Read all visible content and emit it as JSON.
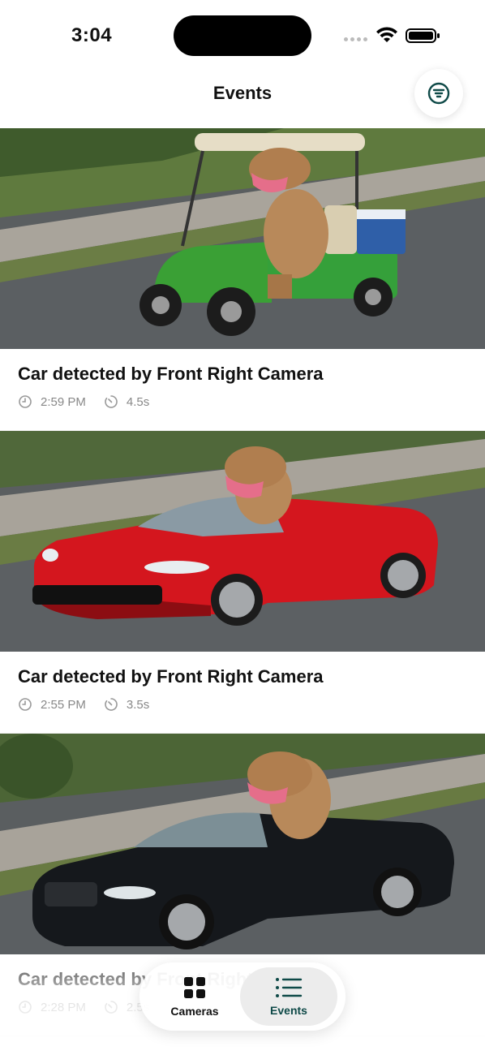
{
  "status_bar": {
    "time": "3:04"
  },
  "header": {
    "title": "Events"
  },
  "theme": {
    "accent": "#0f4a48",
    "secondary_text": "#888888"
  },
  "events": [
    {
      "title": "Car detected by Front Right Camera",
      "time": "2:59 PM",
      "duration": "4.5s"
    },
    {
      "title": "Car detected by Front Right Camera",
      "time": "2:55 PM",
      "duration": "3.5s"
    },
    {
      "title": "Car detected by Front Right Camera",
      "time": "2:28 PM",
      "duration": "2.5s"
    }
  ],
  "tab_bar": {
    "tabs": [
      {
        "label": "Cameras",
        "icon": "grid-icon",
        "active": false
      },
      {
        "label": "Events",
        "icon": "list-icon",
        "active": true
      }
    ]
  }
}
